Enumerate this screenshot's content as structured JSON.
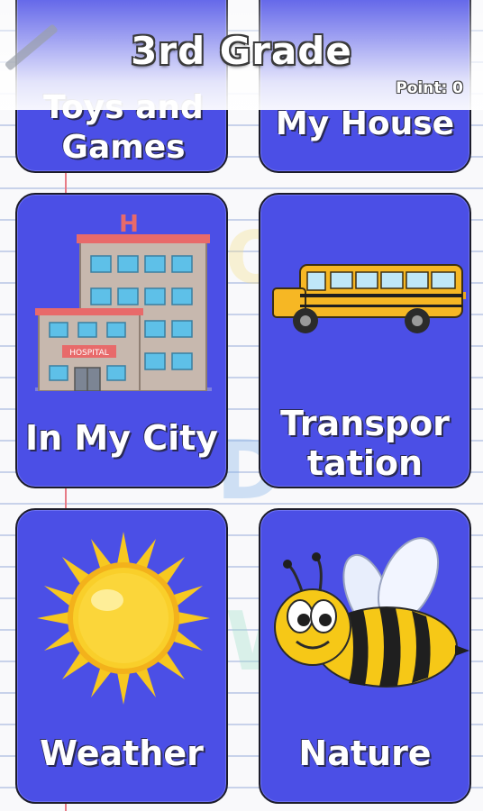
{
  "header": {
    "title": "3rd Grade",
    "points": "Point: 0"
  },
  "cards": [
    {
      "label": "Toys and Games",
      "icon": "toys-icon"
    },
    {
      "label": "My House",
      "icon": "house-icon"
    },
    {
      "label": "In My City",
      "icon": "hospital-icon",
      "badge": "HOSPITAL",
      "sign": "H"
    },
    {
      "label": "Transpor tation",
      "icon": "school-bus-icon"
    },
    {
      "label": "Weather",
      "icon": "sun-icon"
    },
    {
      "label": "Nature",
      "icon": "bee-icon"
    }
  ],
  "colors": {
    "card": "#4b4fe6",
    "card_border": "#1c1c2a",
    "paper_line": "#c8d2ea",
    "margin_line": "#e77b86"
  }
}
